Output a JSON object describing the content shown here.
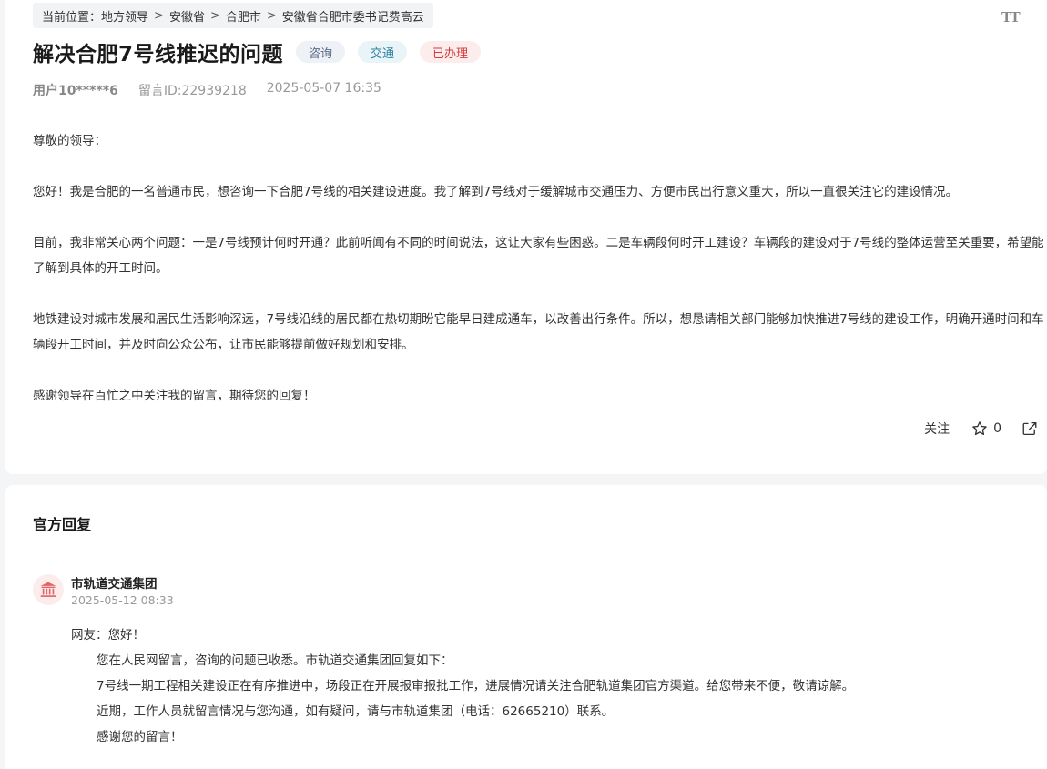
{
  "breadcrumb": {
    "prefix": "当前位置：",
    "items": [
      "地方领导",
      "安徽省",
      "合肥市",
      "安徽省合肥市委书记费高云"
    ],
    "separator": ">"
  },
  "font_toggle": "TT",
  "post": {
    "title": "解决合肥7号线推迟的问题",
    "tags": [
      {
        "label": "咨询"
      },
      {
        "label": "交通"
      },
      {
        "label": "已办理"
      }
    ],
    "user": "用户10*****6",
    "message_id": "留言ID:22939218",
    "datetime": "2025-05-07 16:35",
    "paragraphs": [
      "尊敬的领导：",
      "您好！我是合肥的一名普通市民，想咨询一下合肥7号线的相关建设进度。我了解到7号线对于缓解城市交通压力、方便市民出行意义重大，所以一直很关注它的建设情况。",
      "目前，我非常关心两个问题：一是7号线预计何时开通？此前听闻有不同的时间说法，这让大家有些困惑。二是车辆段何时开工建设？车辆段的建设对于7号线的整体运营至关重要，希望能了解到具体的开工时间。",
      "地铁建设对城市发展和居民生活影响深远，7号线沿线的居民都在热切期盼它能早日建成通车，以改善出行条件。所以，想恳请相关部门能够加快推进7号线的建设工作，明确开通时间和车辆段开工时间，并及时向公众公布，让市民能够提前做好规划和安排。",
      "感谢领导在百忙之中关注我的留言，期待您的回复！"
    ],
    "actions": {
      "follow_label": "关注",
      "star_count": "0"
    }
  },
  "reply": {
    "section_title": "官方回复",
    "org_name": "市轨道交通集团",
    "datetime": "2025-05-12 08:33",
    "greeting": "网友：您好！",
    "lines": [
      "您在人民网留言，咨询的问题已收悉。市轨道交通集团回复如下：",
      "7号线一期工程相关建设正在有序推进中，场段正在开展报审报批工作，进展情况请关注合肥轨道集团官方渠道。给您带来不便，敬请谅解。",
      "近期，工作人员就留言情况与您沟通，如有疑问，请与市轨道集团（电话：62665210）联系。",
      "感谢您的留言！"
    ]
  },
  "colors": {
    "tag_done": "#d23c3c",
    "tag_traffic": "#2a7fa0",
    "tag_consult": "#5a6b86"
  }
}
